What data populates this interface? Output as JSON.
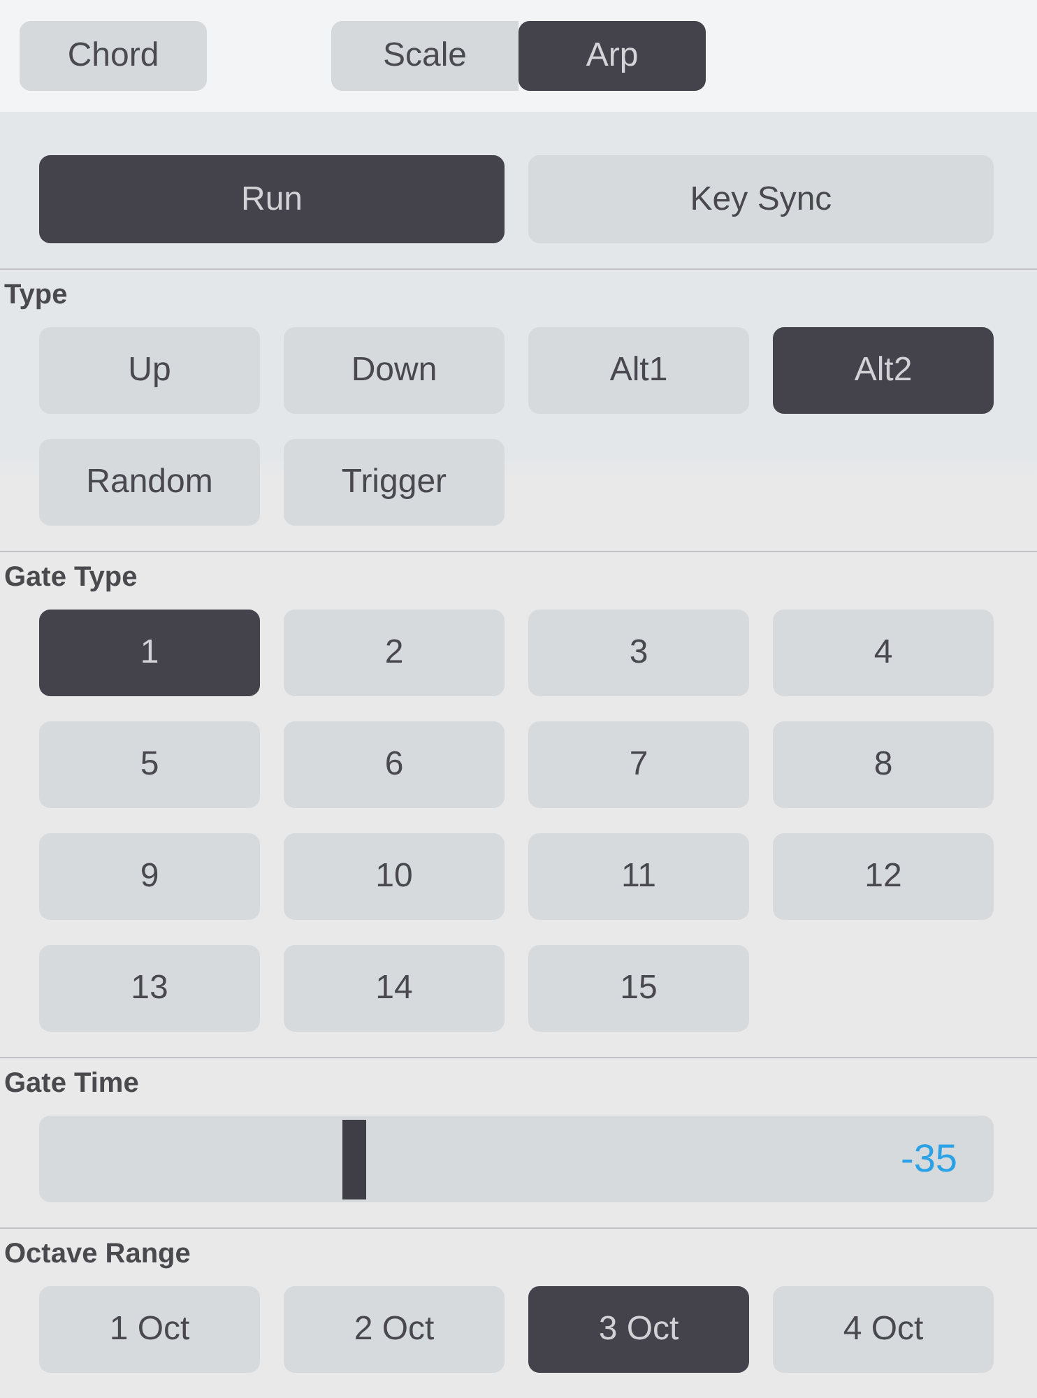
{
  "mode_tabs": [
    {
      "tabs": [
        {
          "label": "Chord",
          "selected": false
        }
      ]
    },
    {
      "tabs": [
        {
          "label": "Scale",
          "selected": false
        },
        {
          "label": "Arp",
          "selected": true
        }
      ]
    }
  ],
  "toggles": [
    {
      "label": "Run",
      "on": true
    },
    {
      "label": "Key Sync",
      "on": false
    }
  ],
  "sections": [
    {
      "title": "Type",
      "kind": "options",
      "options": [
        {
          "label": "Up",
          "selected": false
        },
        {
          "label": "Down",
          "selected": false
        },
        {
          "label": "Alt1",
          "selected": false
        },
        {
          "label": "Alt2",
          "selected": true
        },
        {
          "label": "Random",
          "selected": false
        },
        {
          "label": "Trigger",
          "selected": false
        }
      ]
    },
    {
      "title": "Gate Type",
      "kind": "options",
      "options": [
        {
          "label": "1",
          "selected": true
        },
        {
          "label": "2",
          "selected": false
        },
        {
          "label": "3",
          "selected": false
        },
        {
          "label": "4",
          "selected": false
        },
        {
          "label": "5",
          "selected": false
        },
        {
          "label": "6",
          "selected": false
        },
        {
          "label": "7",
          "selected": false
        },
        {
          "label": "8",
          "selected": false
        },
        {
          "label": "9",
          "selected": false
        },
        {
          "label": "10",
          "selected": false
        },
        {
          "label": "11",
          "selected": false
        },
        {
          "label": "12",
          "selected": false
        },
        {
          "label": "13",
          "selected": false
        },
        {
          "label": "14",
          "selected": false
        },
        {
          "label": "15",
          "selected": false
        }
      ]
    },
    {
      "title": "Gate Time",
      "kind": "slider",
      "slider": {
        "level": 0.33,
        "reading": "-35"
      }
    },
    {
      "title": "Octave Range",
      "kind": "options",
      "options": [
        {
          "label": "1 Oct",
          "selected": false
        },
        {
          "label": "2 Oct",
          "selected": false
        },
        {
          "label": "3 Oct",
          "selected": true
        },
        {
          "label": "4 Oct",
          "selected": false
        }
      ]
    }
  ]
}
